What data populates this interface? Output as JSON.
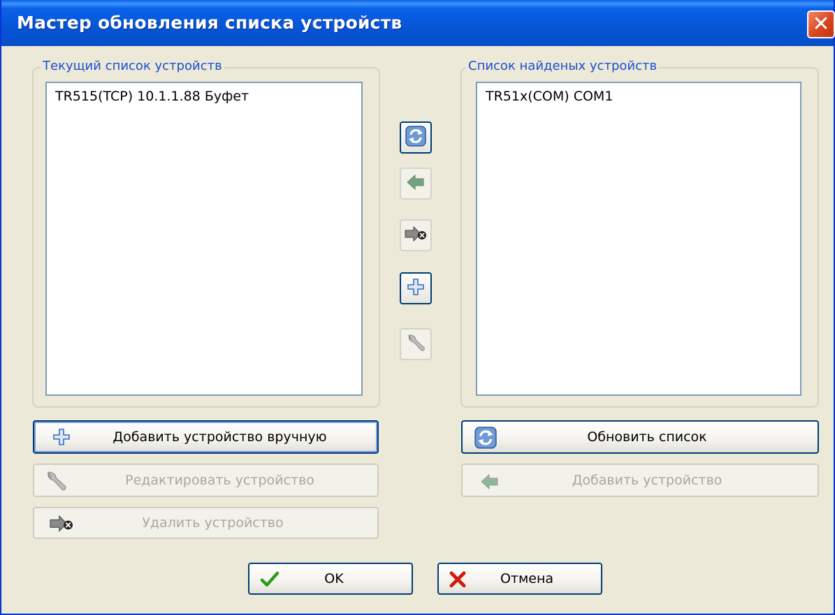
{
  "window": {
    "title": "Мастер обновления списка устройств",
    "close_glyph": "✕"
  },
  "current_list": {
    "label": "Текущий список устройств",
    "items": [
      "TR515(TCP) 10.1.1.88 Буфет"
    ]
  },
  "found_list": {
    "label": "Список найденых устройств",
    "items": [
      "TR51x(COM) COM1"
    ]
  },
  "toolbar": {
    "refresh_icon": "refresh-icon",
    "add_found_icon": "arrow-left-icon",
    "delete_icon": "arrow-delete-icon",
    "add_manual_icon": "plus-icon",
    "edit_icon": "wrench-icon"
  },
  "buttons": {
    "add_manual": "Добавить устройство вручную",
    "edit_device": "Редактировать устройство",
    "delete_device": "Удалить устройство",
    "refresh_list": "Обновить список",
    "add_device": "Добавить устройство",
    "ok": "OK",
    "cancel": "Отмена"
  },
  "colors": {
    "title_bar": "#0a5ee0",
    "accent_label": "#1c4fd0",
    "ok_check": "#2f9a1a",
    "cancel_cross": "#d11b10"
  }
}
